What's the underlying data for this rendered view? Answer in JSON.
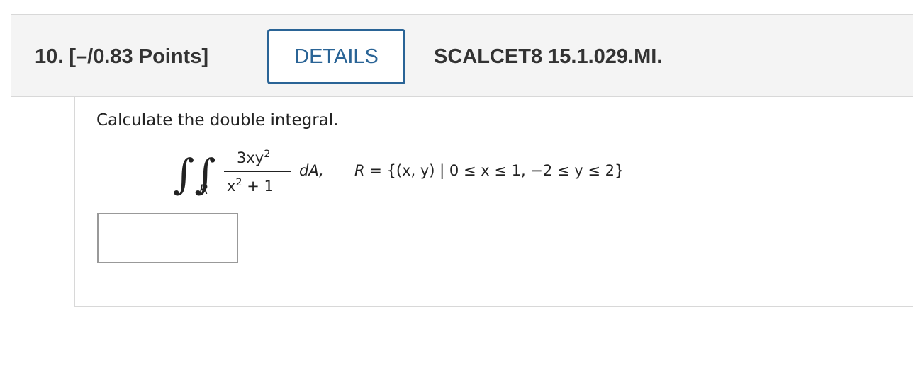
{
  "header": {
    "question_number": "10.",
    "points": "[–/0.83 Points]",
    "details_label": "DETAILS",
    "problem_id": "SCALCET8 15.1.029.MI."
  },
  "question": {
    "instruction": "Calculate the double integral.",
    "formula": {
      "integral_symbol": "∫∫",
      "region_subscript": "R",
      "numerator": {
        "base": "3xy",
        "exponent": "2"
      },
      "denominator": {
        "base": "x",
        "exponent": "2",
        "tail": " + 1"
      },
      "differential": "dA,",
      "region_name": "R",
      "region_set": " = {(x, y) | 0 ≤ x ≤ 1, −2 ≤ y ≤ 2}"
    },
    "answer": {
      "value": "",
      "placeholder": ""
    }
  },
  "colors": {
    "header_background": "#f4f4f4",
    "details_accent": "#2a6496",
    "border": "#d8d8d8"
  }
}
